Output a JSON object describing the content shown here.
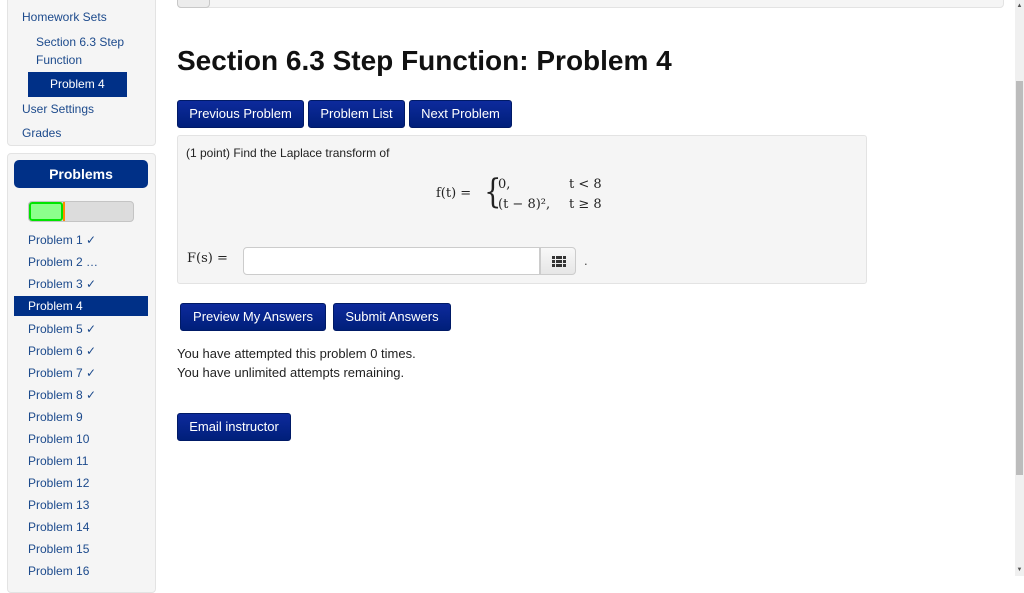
{
  "nav": {
    "homework_sets": "Homework Sets",
    "set_name": "Section 6.3 Step Function",
    "set_name_line1": "Section 6.3 Step",
    "set_name_line2": "Function",
    "current_problem": "Problem 4",
    "user_settings": "User Settings",
    "grades": "Grades"
  },
  "problems_panel": {
    "header": "Problems",
    "progress": {
      "correct_percent": 33,
      "incorrect_percent": 2,
      "colors": {
        "correct": "#8cff8c",
        "incorrect": "#ffd800"
      }
    },
    "items": [
      {
        "label": "Problem 1 ✓",
        "status": "correct"
      },
      {
        "label": "Problem 2 …",
        "status": "partial"
      },
      {
        "label": "Problem 3 ✓",
        "status": "correct"
      },
      {
        "label": "Problem 4",
        "status": "current"
      },
      {
        "label": "Problem 5 ✓",
        "status": "correct"
      },
      {
        "label": "Problem 6 ✓",
        "status": "correct"
      },
      {
        "label": "Problem 7 ✓",
        "status": "correct"
      },
      {
        "label": "Problem 8 ✓",
        "status": "correct"
      },
      {
        "label": "Problem 9",
        "status": "none"
      },
      {
        "label": "Problem 10",
        "status": "none"
      },
      {
        "label": "Problem 11",
        "status": "none"
      },
      {
        "label": "Problem 12",
        "status": "none"
      },
      {
        "label": "Problem 13",
        "status": "none"
      },
      {
        "label": "Problem 14",
        "status": "none"
      },
      {
        "label": "Problem 15",
        "status": "none"
      },
      {
        "label": "Problem 16",
        "status": "none"
      }
    ]
  },
  "main": {
    "title": "Section 6.3 Step Function: Problem 4",
    "nav_buttons": {
      "previous": "Previous Problem",
      "list": "Problem List",
      "next": "Next Problem"
    },
    "problem": {
      "prompt": "(1 point) Find the Laplace transform of",
      "f_lhs": "f(t) =",
      "cases": [
        {
          "expr": "0,",
          "cond": "t < 8"
        },
        {
          "expr": "(t − 8)²,",
          "cond": "t ≥ 8"
        }
      ],
      "answer_label": "F(s) =",
      "answer_value": "",
      "answer_placeholder": "",
      "equation_editor_icon": "grid-icon",
      "trailing_period": "."
    },
    "actions": {
      "preview": "Preview My Answers",
      "submit": "Submit Answers"
    },
    "attempts": {
      "line1": "You have attempted this problem 0 times.",
      "line2": "You have unlimited attempts remaining."
    },
    "email_instructor": "Email instructor"
  },
  "colors": {
    "primary": "#003087",
    "link": "#1c4a8c",
    "panel_bg": "#f5f5f5"
  }
}
